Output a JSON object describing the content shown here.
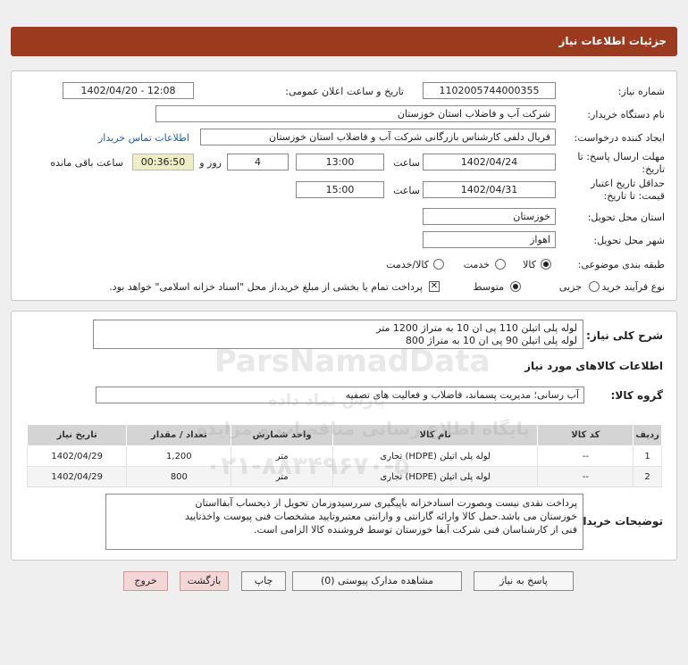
{
  "header": {
    "title": "جزئیات اطلاعات نیاز"
  },
  "form": {
    "need_number_label": "شماره نیاز:",
    "need_number": "1102005744000355",
    "announce_label": "تاریخ و ساعت اعلان عمومی:",
    "announce_value": "1402/04/20 - 12:08",
    "buyer_label": "نام دستگاه خریدار:",
    "buyer_value": "شرکت آب و فاضلاب استان خوزستان",
    "creator_label": "ایجاد کننده درخواست:",
    "creator_value": "فریال دلفی کارشناس بازرگانی شرکت آب و فاضلاب استان خوزستان",
    "contact_link": "اطلاعات تماس خریدار",
    "deadline_label_1": "مهلت ارسال پاسخ: تا",
    "deadline_label_2": "تاریخ:",
    "deadline_date": "1402/04/24",
    "time_label": "ساعت",
    "deadline_time": "13:00",
    "days_value": "4",
    "days_label": "روز و",
    "remaining_time": "00:36:50",
    "remaining_label": "ساعت باقی مانده",
    "validity_label_1": "حداقل تاریخ اعتبار",
    "validity_label_2": "قیمت: تا تاریخ:",
    "validity_date": "1402/04/31",
    "validity_time": "15:00",
    "province_label": "استان محل تحویل:",
    "province_value": "خوزستان",
    "city_label": "شهر محل تحویل:",
    "city_value": "اهواز",
    "category_label": "طبقه بندی موضوعی:",
    "category_options": [
      "کالا",
      "خدمت",
      "کالا/خدمت"
    ],
    "process_label": "نوع فرآیند خرید :",
    "process_options": [
      "جزیی",
      "متوسط"
    ],
    "payment_note": "پرداخت تمام یا بخشی از مبلغ خرید،از محل \"اسناد خزانه اسلامی\" خواهد بود."
  },
  "description": {
    "label": "شرح کلی نیاز:",
    "line1": "لوله پلی اتیلن 110 پی ان 10 به متراژ 1200 متر",
    "line2": "لوله پلی اتیلن 90 پی ان 10 به متراژ 800",
    "goods_info_title": "اطلاعات کالاهای مورد نیاز",
    "group_label": "گروه کالا:",
    "group_value": "آب رسانی؛ مدیریت پسماند، فاضلاب و فعالیت های تصفیه"
  },
  "table": {
    "headers": [
      "ردیف",
      "کد کالا",
      "نام کالا",
      "واحد شمارش",
      "تعداد / مقدار",
      "تاریخ نیاز"
    ],
    "rows": [
      [
        "1",
        "--",
        "لوله پلی اتیلن (HDPE) تجاری",
        "متر",
        "1,200",
        "1402/04/29"
      ],
      [
        "2",
        "--",
        "لوله پلی اتیلن (HDPE) تجاری",
        "متر",
        "800",
        "1402/04/29"
      ]
    ]
  },
  "buyer_notes": {
    "label": "توضیحات خریدار:",
    "line1": "پرداخت نقدی نیست وبصورت اسنادخزانه باپیگیری سررسیدوزمان تحویل از ذیحساب آبفااستان",
    "line2": "خوزستان می باشد.حمل کالا وارائه گارانتی و وارانتی معتبروتایید مشخصات فنی پیوست واخذتایید",
    "line3": "فنی از کارشناسان فنی شرکت آبفا خوزستان توسط فروشنده کالا الزامی است."
  },
  "buttons": {
    "reply": "پاسخ به نیاز",
    "attachments": "مشاهده مدارک پیوستی (0)",
    "print": "چاپ",
    "back": "بازگشت",
    "exit": "خروج"
  },
  "watermark": {
    "brand": "ParsNamadData",
    "line_fa1": "پایگاه اطلاع رسانی مناقصات و مزایده",
    "line_fa2": "پارس نماد داده",
    "phone": "۰۲۱-۸۸۳۴۹۶۷۰-۵"
  }
}
